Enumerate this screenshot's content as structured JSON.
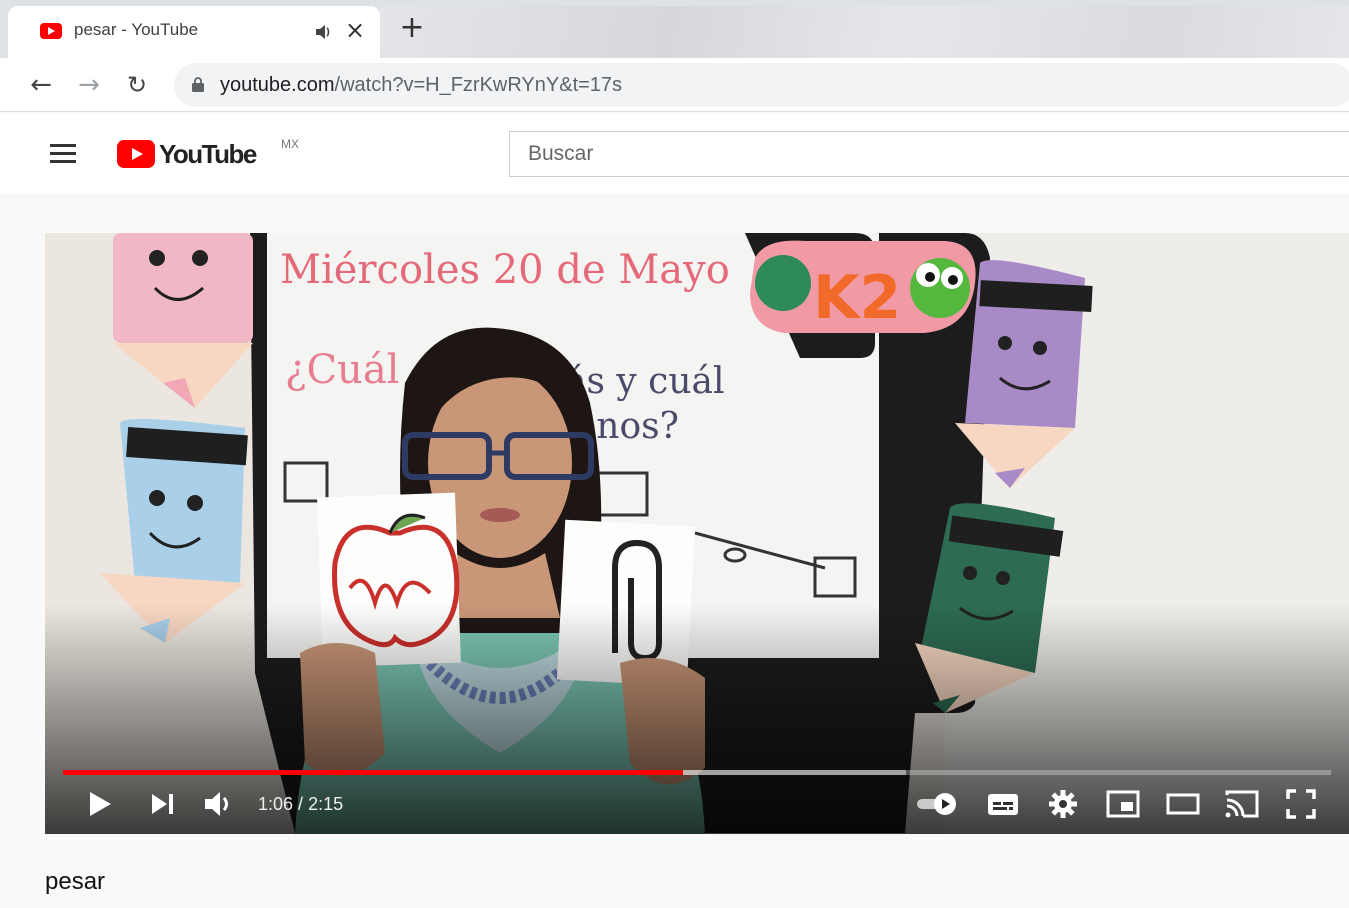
{
  "browser": {
    "tab_title": "pesar - YouTube",
    "url_host": "youtube.com",
    "url_path": "/watch?v=H_FzrKwRYnY&t=17s"
  },
  "masthead": {
    "logo_text": "YouTube",
    "region": "MX",
    "search_placeholder": "Buscar"
  },
  "video": {
    "board_line1": "Miércoles 20 de Mayo",
    "board_line2_left": "¿Cuál",
    "board_line2_right": "ás y cuál",
    "board_line3": "enos?",
    "badge_text": "K2"
  },
  "player": {
    "current_time": "1:06",
    "duration": "2:15",
    "time_separator": " / ",
    "progress_fraction": 0.489,
    "buffered_fraction": 0.665
  },
  "title": "pesar",
  "colors": {
    "accent_red": "#ff0000"
  }
}
